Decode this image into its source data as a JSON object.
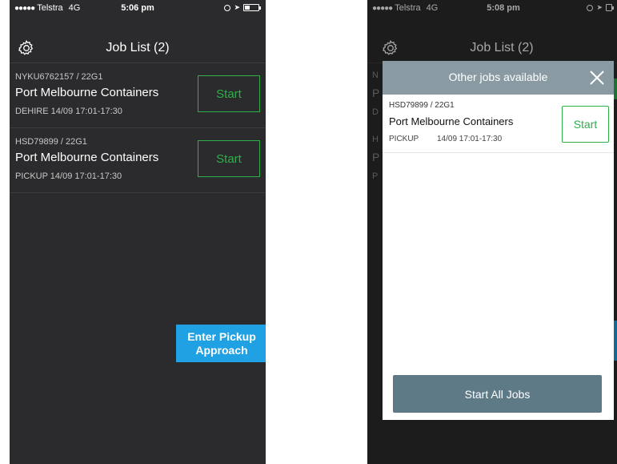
{
  "left_screen": {
    "status_bar": {
      "carrier_dots": "●●●●●",
      "carrier": "Telstra",
      "network": "4G",
      "time": "5:06 pm",
      "location_arrow": "➤"
    },
    "nav": {
      "title": "Job List (2)",
      "settings_icon": "gear-icon"
    },
    "jobs": [
      {
        "ref": "NYKU6762157 / 22G1",
        "name": "Port Melbourne Containers",
        "meta": "DEHIRE  14/09 17:01-17:30",
        "start_label": "Start"
      },
      {
        "ref": "HSD79899 / 22G1",
        "name": "Port Melbourne Containers",
        "meta": "PICKUP  14/09 17:01-17:30",
        "start_label": "Start"
      }
    ],
    "pickup_button": {
      "line1": "Enter Pickup",
      "line2": "Approach"
    }
  },
  "right_screen": {
    "status_bar": {
      "carrier_dots": "●●●●●",
      "carrier": "Telstra",
      "network": "4G",
      "time": "5:08 pm",
      "location_arrow": "➤"
    },
    "nav": {
      "title": "Job List (2)",
      "settings_icon": "gear-icon"
    },
    "background_peek": [
      "N",
      "P",
      "D",
      "H",
      "P",
      "P"
    ],
    "modal": {
      "title": "Other jobs available",
      "close_icon": "close-icon",
      "job": {
        "ref": "HSD79899 / 22G1",
        "name": "Port Melbourne Containers",
        "type": "PICKUP",
        "time": "14/09 17:01-17:30",
        "start_label": "Start"
      },
      "start_all_label": "Start All Jobs"
    }
  },
  "colors": {
    "app_background": "#2b2b2d",
    "start_green": "#2fae4a",
    "pickup_blue": "#1fa1e3",
    "modal_header": "#8a9aa3",
    "start_all_button": "#5e7a87"
  }
}
